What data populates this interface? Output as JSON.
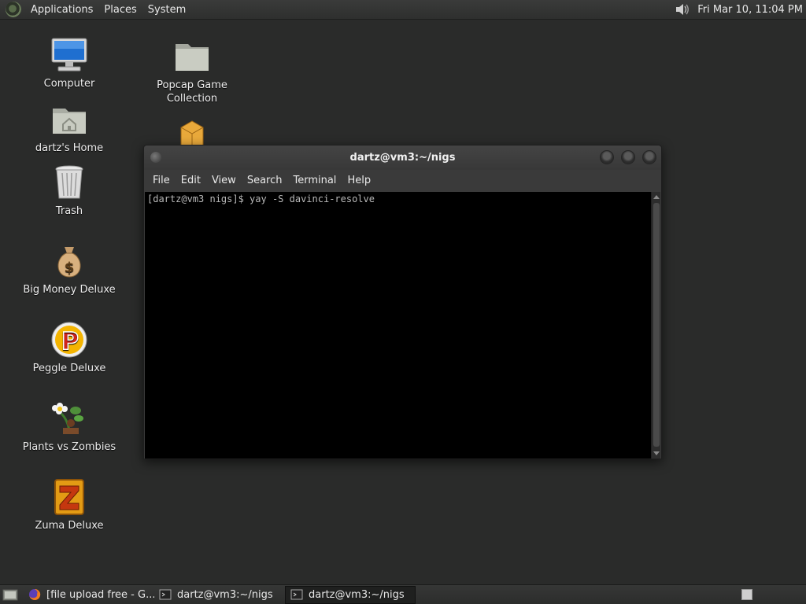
{
  "top_panel": {
    "menus": [
      "Applications",
      "Places",
      "System"
    ],
    "clock": "Fri Mar 10, 11:04 PM",
    "icons": {
      "menu_logo": "distro-logo-icon",
      "volume": "speaker-volume-icon"
    }
  },
  "desktop": {
    "icons": [
      {
        "label": "Computer",
        "icon": "computer-monitor-icon"
      },
      {
        "label": "dartz's Home",
        "icon": "home-folder-icon"
      },
      {
        "label": "Trash",
        "icon": "trash-can-icon"
      },
      {
        "label": "Big Money Deluxe",
        "icon": "money-bag-icon"
      },
      {
        "label": "Peggle Deluxe",
        "icon": "peggle-icon"
      },
      {
        "label": "Plants vs Zombies",
        "icon": "plants-vs-zombies-icon"
      },
      {
        "label": "Zuma Deluxe",
        "icon": "zuma-icon"
      },
      {
        "label": "Popcap Game Collection",
        "icon": "folder-icon"
      },
      {
        "label": "",
        "icon": "package-box-icon"
      }
    ]
  },
  "terminal": {
    "title": "dartz@vm3:~/nigs",
    "menu": [
      "File",
      "Edit",
      "View",
      "Search",
      "Terminal",
      "Help"
    ],
    "lines": [
      "[dartz@vm3 nigs]$ yay -S davinci-resolve"
    ]
  },
  "taskbar": {
    "tasks": [
      {
        "label": "[file upload free - G...",
        "icon": "firefox-icon",
        "active": false
      },
      {
        "label": "dartz@vm3:~/nigs",
        "icon": "terminal-icon",
        "active": false
      },
      {
        "label": "dartz@vm3:~/nigs",
        "icon": "terminal-icon",
        "active": true
      }
    ],
    "icons": {
      "show_desktop": "show-desktop-icon",
      "workspace": "workspace-switcher-icon"
    }
  },
  "colors": {
    "desktop_bg": "#2a2b2a",
    "panel_bg": "#333433",
    "terminal_bg": "#000000",
    "terminal_text": "#b8b8b8"
  }
}
